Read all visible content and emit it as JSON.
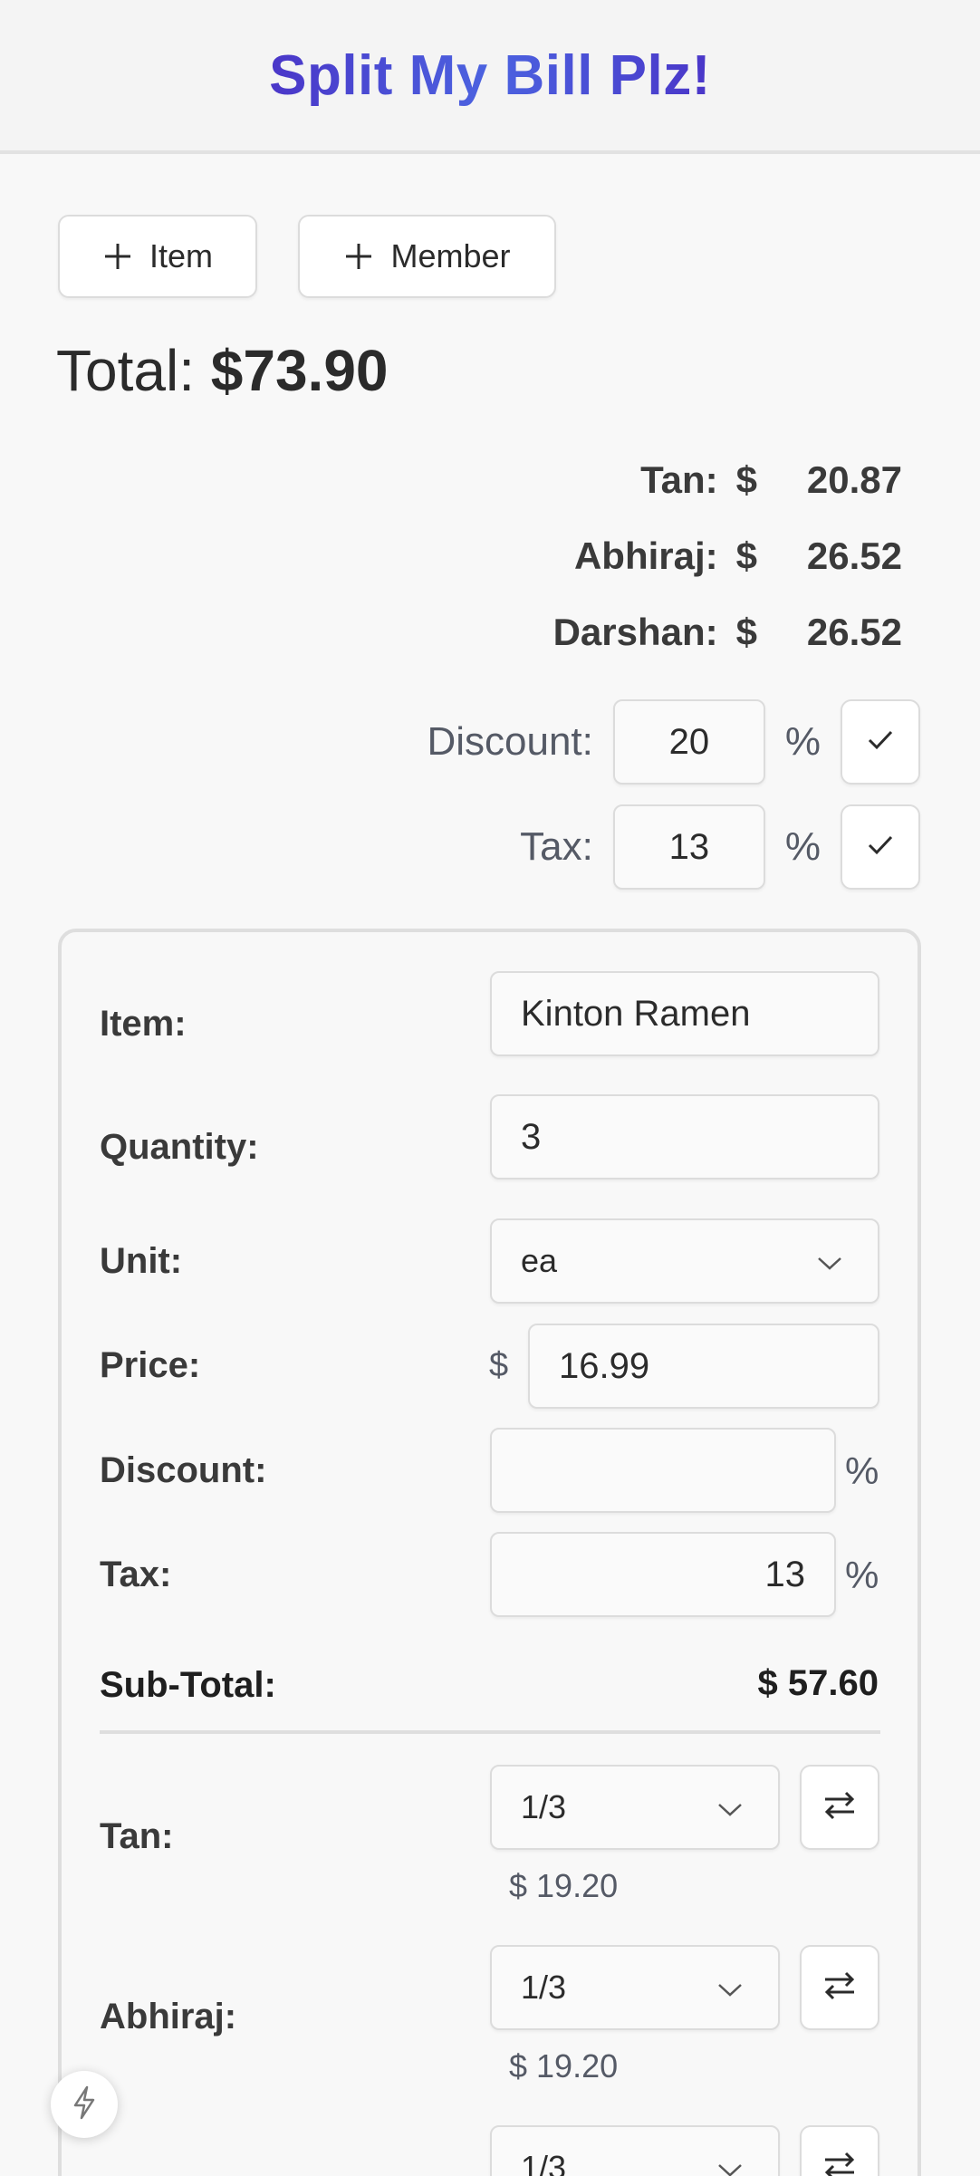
{
  "app": {
    "title": "Split My Bill Plz!"
  },
  "toolbar": {
    "add_item_label": "Item",
    "add_member_label": "Member"
  },
  "summary": {
    "total_label": "Total:",
    "total_value": "$73.90",
    "members": [
      {
        "name": "Tan:",
        "currency": "$",
        "amount": "20.87"
      },
      {
        "name": "Abhiraj:",
        "currency": "$",
        "amount": "26.52"
      },
      {
        "name": "Darshan:",
        "currency": "$",
        "amount": "26.52"
      }
    ],
    "discount": {
      "label": "Discount:",
      "value": "20",
      "unit": "%"
    },
    "tax": {
      "label": "Tax:",
      "value": "13",
      "unit": "%"
    }
  },
  "item": {
    "item_label": "Item:",
    "item_value": "Kinton Ramen",
    "quantity_label": "Quantity:",
    "quantity_value": "3",
    "unit_label": "Unit:",
    "unit_value": "ea",
    "price_label": "Price:",
    "price_currency": "$",
    "price_value": "16.99",
    "discount_label": "Discount:",
    "discount_value": "",
    "discount_unit": "%",
    "tax_label": "Tax:",
    "tax_value": "13",
    "tax_unit": "%",
    "subtotal_label": "Sub-Total:",
    "subtotal_value": "$ 57.60",
    "splits": [
      {
        "name": "Tan:",
        "share": "1/3",
        "amount": "$ 19.20"
      },
      {
        "name": "Abhiraj:",
        "share": "1/3",
        "amount": "$ 19.20"
      },
      {
        "name": "",
        "share": "1/3",
        "amount": ""
      }
    ]
  },
  "colors": {
    "title_gradient_start": "#4a36c8",
    "title_gradient_end": "#4b63e0"
  },
  "icons": {
    "add": "plus-icon",
    "confirm": "check-icon",
    "swap": "swap-arrows-icon",
    "dropdown": "chevron-down-icon",
    "fab": "lightning-icon"
  }
}
